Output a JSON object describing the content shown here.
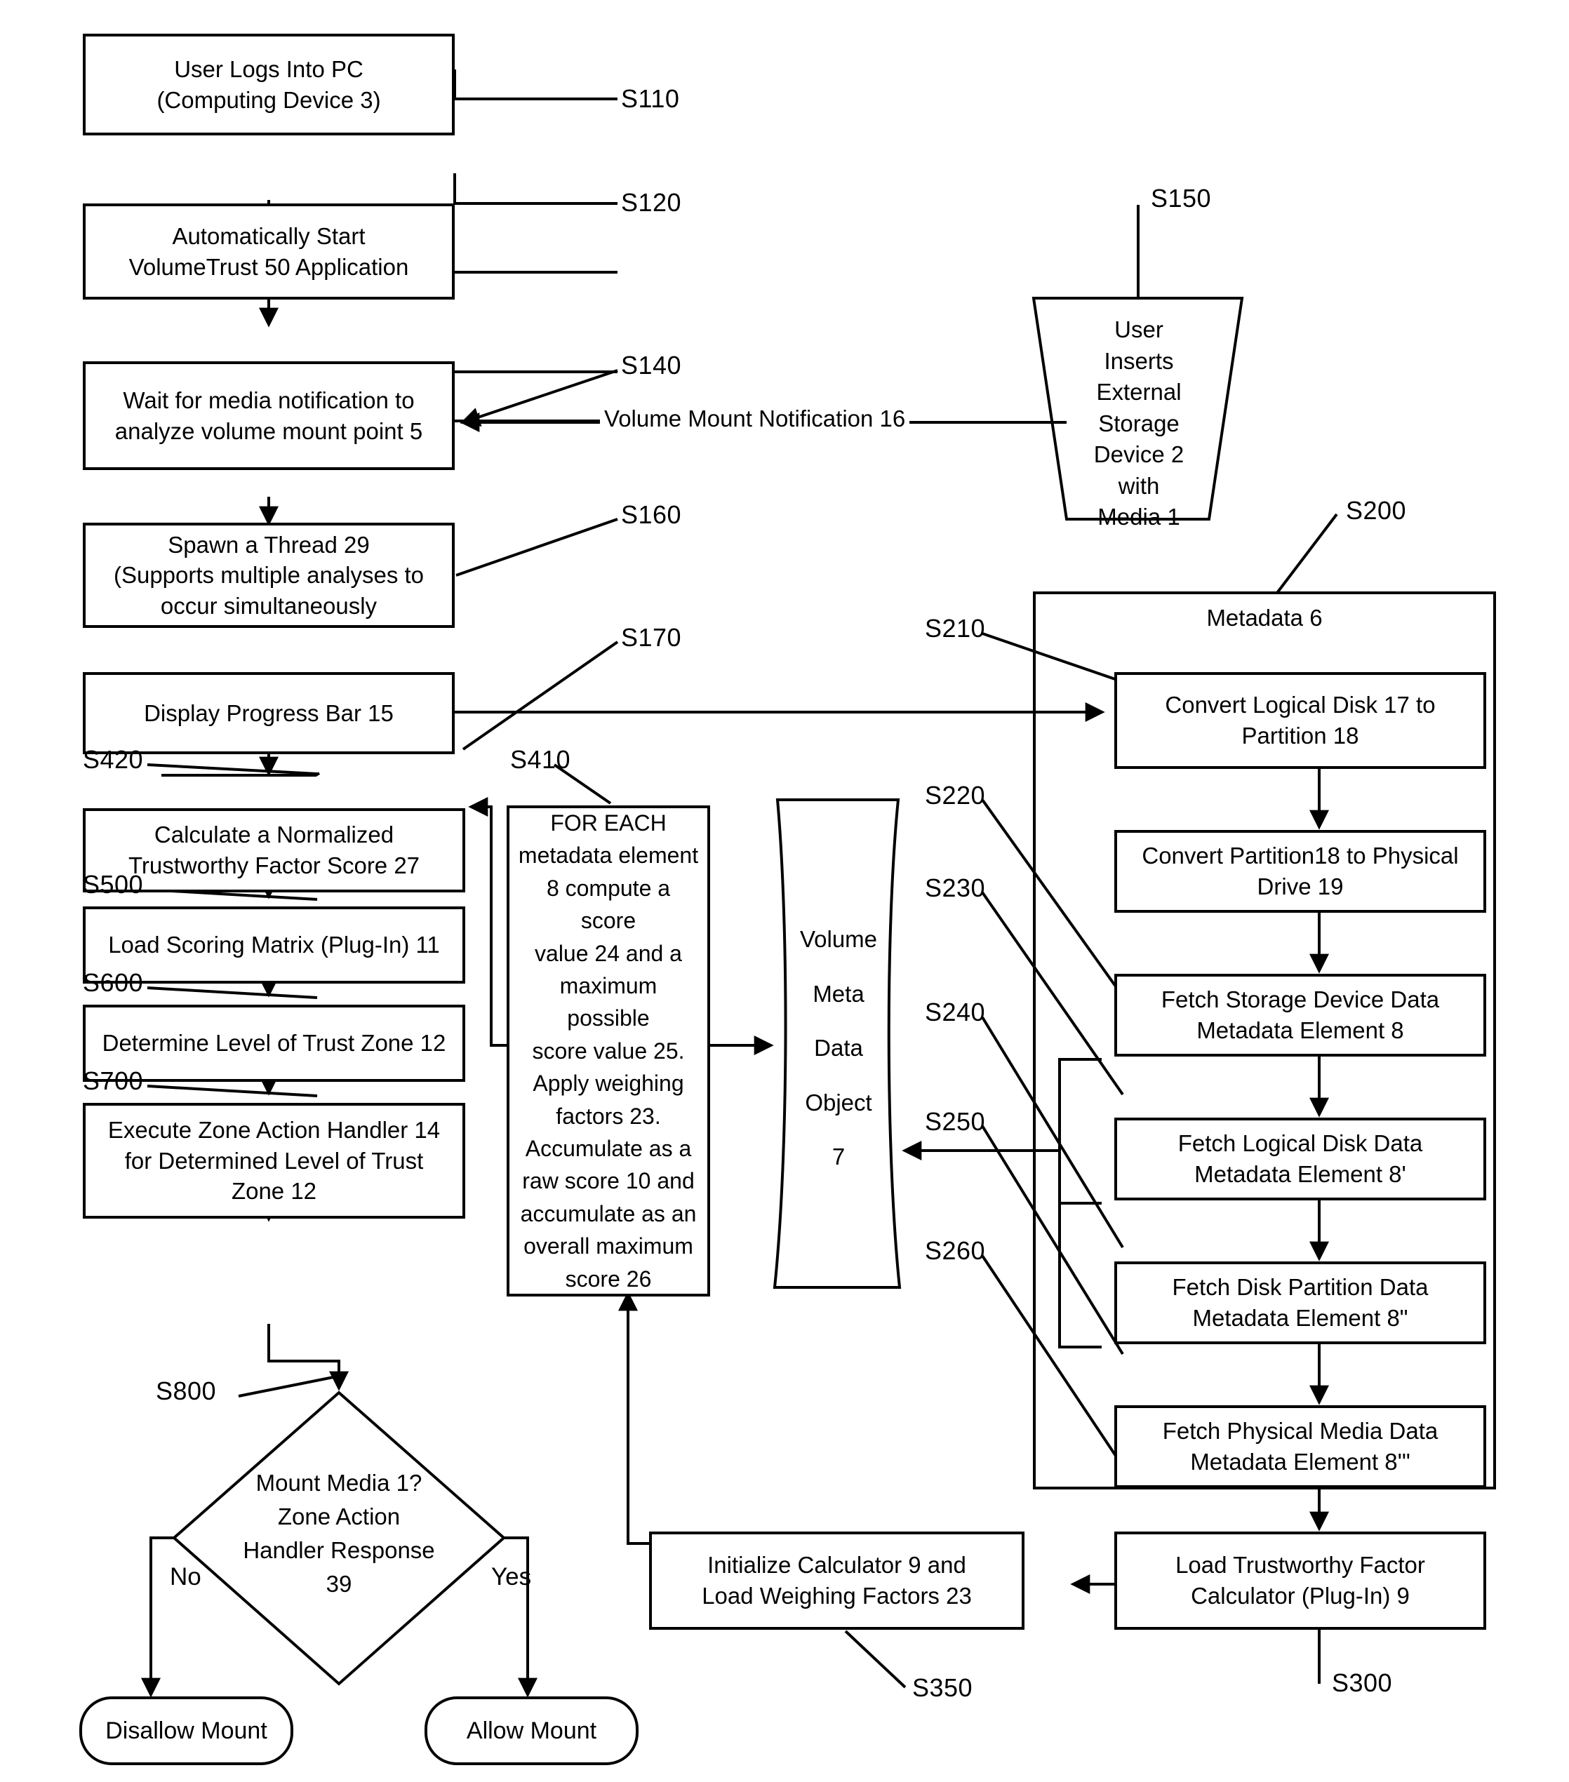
{
  "diagram": {
    "type": "flowchart",
    "title_present": false,
    "colors": {
      "stroke": "#000000",
      "fill": "#ffffff"
    }
  },
  "nodes": {
    "user_logs_in": "User Logs Into PC\n(Computing Device 3)",
    "auto_start": "Automatically Start\nVolumeTrust 50 Application",
    "wait_media": "Wait for media notification to\nanalyze volume mount point 5",
    "spawn_thread": "Spawn a Thread 29\n(Supports multiple analyses to\noccur simultaneously",
    "display_progress": "Display Progress Bar 15",
    "calc_normalized": "Calculate a Normalized\nTrustworthy Factor Score 27",
    "load_matrix": "Load Scoring Matrix (Plug-In) 11",
    "determine_zone": "Determine Level of Trust Zone 12",
    "execute_handler": "Execute Zone Action Handler 14\nfor Determined Level of Trust\nZone 12",
    "decision": "Mount Media 1?\nZone Action\nHandler Response\n39",
    "disallow_mount": "Disallow Mount",
    "allow_mount": "Allow Mount",
    "user_inserts": "User\nInserts\nExternal\nStorage\nDevice 2\nwith\nMedia 1",
    "for_each": "FOR EACH\nmetadata element\n8 compute a score\nvalue 24 and a\nmaximum possible\nscore value 25.\nApply weighing\nfactors 23.\nAccumulate as a\nraw score 10 and\naccumulate as an\noverall maximum\nscore 26",
    "volume_meta_object": "Volume\nMeta\nData\nObject\n7",
    "metadata_group_title": "Metadata 6",
    "convert_logical": "Convert Logical Disk 17 to\nPartition 18",
    "convert_partition": "Convert Partition18 to Physical\nDrive 19",
    "fetch_storage": "Fetch Storage Device Data\nMetadata Element 8",
    "fetch_logical": "Fetch Logical Disk Data\nMetadata Element 8'",
    "fetch_disk_partition": "Fetch Disk Partition Data\nMetadata Element 8\"",
    "fetch_physical_media": "Fetch Physical Media Data\nMetadata Element 8'\"",
    "load_calculator": "Load Trustworthy Factor\nCalculator (Plug-In) 9",
    "init_calculator": "Initialize Calculator 9 and\nLoad Weighing Factors 23"
  },
  "step_labels": {
    "s110": "S110",
    "s120": "S120",
    "s140": "S140",
    "s150": "S150",
    "s160": "S160",
    "s170": "S170",
    "s200": "S200",
    "s210": "S210",
    "s220": "S220",
    "s230": "S230",
    "s240": "S240",
    "s250": "S250",
    "s260": "S260",
    "s300": "S300",
    "s350": "S350",
    "s410": "S410",
    "s420": "S420",
    "s500": "S500",
    "s600": "S600",
    "s700": "S700",
    "s800": "S800"
  },
  "edge_labels": {
    "volume_mount_notification": "Volume Mount Notification 16",
    "decision_no": "No",
    "decision_yes": "Yes"
  }
}
